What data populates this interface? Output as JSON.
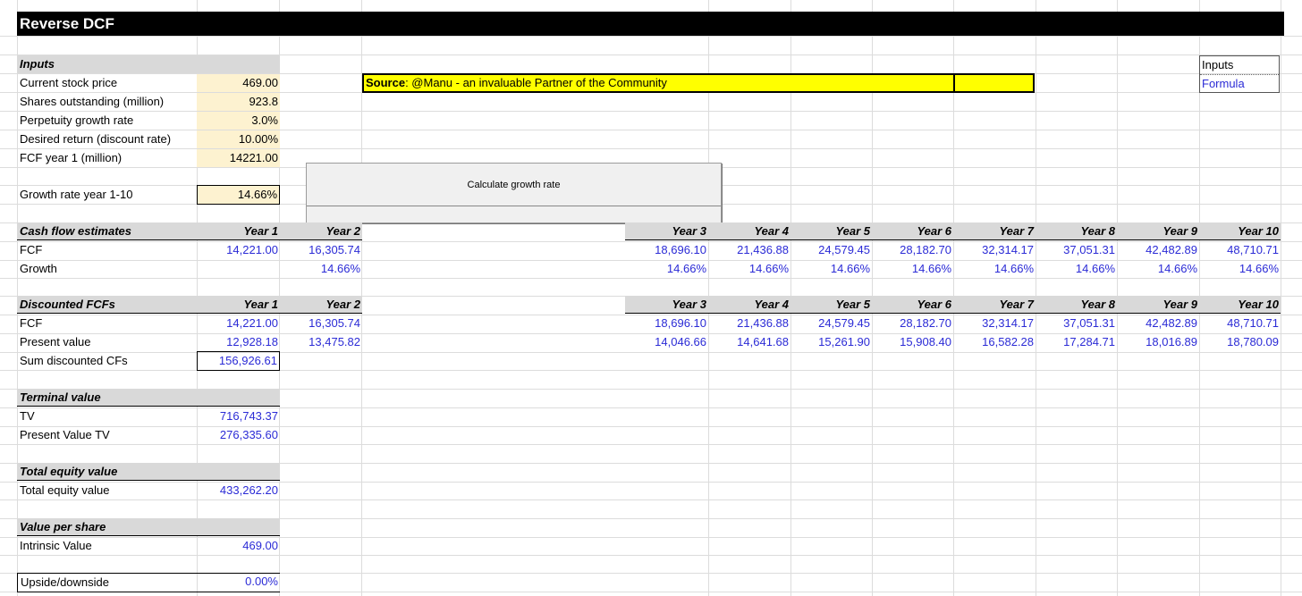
{
  "title": "Reverse DCF",
  "source": {
    "label": "Source",
    "text": ": @Manu - an invaluable Partner of the Community"
  },
  "legend": {
    "inputs": "Inputs",
    "formula": "Formula"
  },
  "calc_button": "Calculate growth rate",
  "inputs": {
    "header": "Inputs",
    "rows": [
      {
        "label": "Current stock price",
        "value": "469.00"
      },
      {
        "label": "Shares outstanding (million)",
        "value": "923.8"
      },
      {
        "label": "Perpetuity growth rate",
        "value": "3.0%"
      },
      {
        "label": "Desired return (discount rate)",
        "value": "10.00%"
      },
      {
        "label": "FCF year 1 (million)",
        "value": "14221.00"
      }
    ],
    "growth_label": "Growth rate year 1-10",
    "growth_value": "14.66%"
  },
  "years": [
    "Year 1",
    "Year 2",
    "Year 3",
    "Year 4",
    "Year 5",
    "Year 6",
    "Year 7",
    "Year 8",
    "Year 9",
    "Year 10"
  ],
  "cash_flow": {
    "header": "Cash flow estimates",
    "fcf_label": "FCF",
    "growth_label": "Growth",
    "fcf": [
      "14,221.00",
      "16,305.74",
      "18,696.10",
      "21,436.88",
      "24,579.45",
      "28,182.70",
      "32,314.17",
      "37,051.31",
      "42,482.89",
      "48,710.71"
    ],
    "growth": [
      "",
      "14.66%",
      "14.66%",
      "14.66%",
      "14.66%",
      "14.66%",
      "14.66%",
      "14.66%",
      "14.66%",
      "14.66%"
    ]
  },
  "discounted": {
    "header": "Discounted FCFs",
    "fcf_label": "FCF",
    "pv_label": "Present value",
    "sum_label": "Sum discounted CFs",
    "fcf": [
      "14,221.00",
      "16,305.74",
      "18,696.10",
      "21,436.88",
      "24,579.45",
      "28,182.70",
      "32,314.17",
      "37,051.31",
      "42,482.89",
      "48,710.71"
    ],
    "pv": [
      "12,928.18",
      "13,475.82",
      "14,046.66",
      "14,641.68",
      "15,261.90",
      "15,908.40",
      "16,582.28",
      "17,284.71",
      "18,016.89",
      "18,780.09"
    ],
    "sum": "156,926.61"
  },
  "terminal": {
    "header": "Terminal value",
    "tv_label": "TV",
    "tv": "716,743.37",
    "pv_label": "Present Value TV",
    "pv": "276,335.60"
  },
  "equity": {
    "header": "Total equity value",
    "label": "Total equity value",
    "value": "433,262.20"
  },
  "per_share": {
    "header": "Value per share",
    "label": "Intrinsic Value",
    "value": "469.00"
  },
  "upside": {
    "label": "Upside/downside",
    "value": "0.00%"
  }
}
